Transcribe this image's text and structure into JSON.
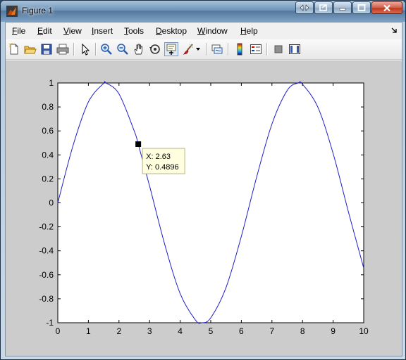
{
  "window": {
    "title": "Figure 1"
  },
  "menu": {
    "items": [
      {
        "label": "File",
        "ul": "F",
        "rest": "ile"
      },
      {
        "label": "Edit",
        "ul": "E",
        "rest": "dit"
      },
      {
        "label": "View",
        "ul": "V",
        "rest": "iew"
      },
      {
        "label": "Insert",
        "ul": "I",
        "rest": "nsert"
      },
      {
        "label": "Tools",
        "ul": "T",
        "rest": "ools"
      },
      {
        "label": "Desktop",
        "ul": "D",
        "rest": "esktop"
      },
      {
        "label": "Window",
        "ul": "W",
        "rest": "indow"
      },
      {
        "label": "Help",
        "ul": "H",
        "rest": "elp"
      }
    ]
  },
  "toolbar": {
    "icons": [
      "new-figure-icon",
      "open-file-icon",
      "save-icon",
      "print-icon",
      "edit-plot-arrow-icon",
      "zoom-in-icon",
      "zoom-out-icon",
      "pan-hand-icon",
      "rotate-3d-icon",
      "data-cursor-icon",
      "brush-icon",
      "brush-dropdown-icon",
      "link-plot-icon",
      "colorbar-icon",
      "legend-icon",
      "hide-plot-tools-icon",
      "show-plot-tools-icon"
    ],
    "active": "data-cursor-icon"
  },
  "colors": {
    "line": "#1f1fc8",
    "axes_bg": "#ffffff",
    "figure_bg": "#cccccc",
    "datatip_bg": "#ffffe0"
  },
  "chart_data": {
    "type": "line",
    "function": "sin(x)",
    "x_range": [
      0,
      10
    ],
    "xlim": [
      0,
      10
    ],
    "ylim": [
      -1,
      1
    ],
    "xticks": [
      "0",
      "1",
      "2",
      "3",
      "4",
      "5",
      "6",
      "7",
      "8",
      "9",
      "10"
    ],
    "yticks": [
      "1",
      "0.8",
      "0.6",
      "0.4",
      "0.2",
      "0",
      "-0.2",
      "-0.4",
      "-0.6",
      "-0.8",
      "-1"
    ],
    "series": [
      {
        "x": [
          0,
          0.5,
          1,
          1.5,
          1.5708,
          2,
          2.5,
          2.63,
          3,
          3.5,
          4,
          4.5,
          4.7124,
          5,
          5.5,
          6,
          6.5,
          7,
          7.5,
          7.854,
          8,
          8.5,
          9,
          9.5,
          10
        ],
        "y": [
          0,
          0.4794,
          0.8415,
          0.9975,
          1,
          0.9093,
          0.5985,
          0.4896,
          0.1411,
          -0.3508,
          -0.7568,
          -0.9775,
          -1,
          -0.9589,
          -0.7055,
          -0.2794,
          0.2151,
          0.657,
          0.938,
          1,
          0.9894,
          0.7985,
          0.4121,
          -0.0752,
          -0.544
        ]
      }
    ],
    "datatip": {
      "x": 2.63,
      "y": 0.4896,
      "label_x": "X: 2.63",
      "label_y": "Y: 0.4896"
    },
    "grid": false,
    "title": "",
    "xlabel": "",
    "ylabel": ""
  }
}
